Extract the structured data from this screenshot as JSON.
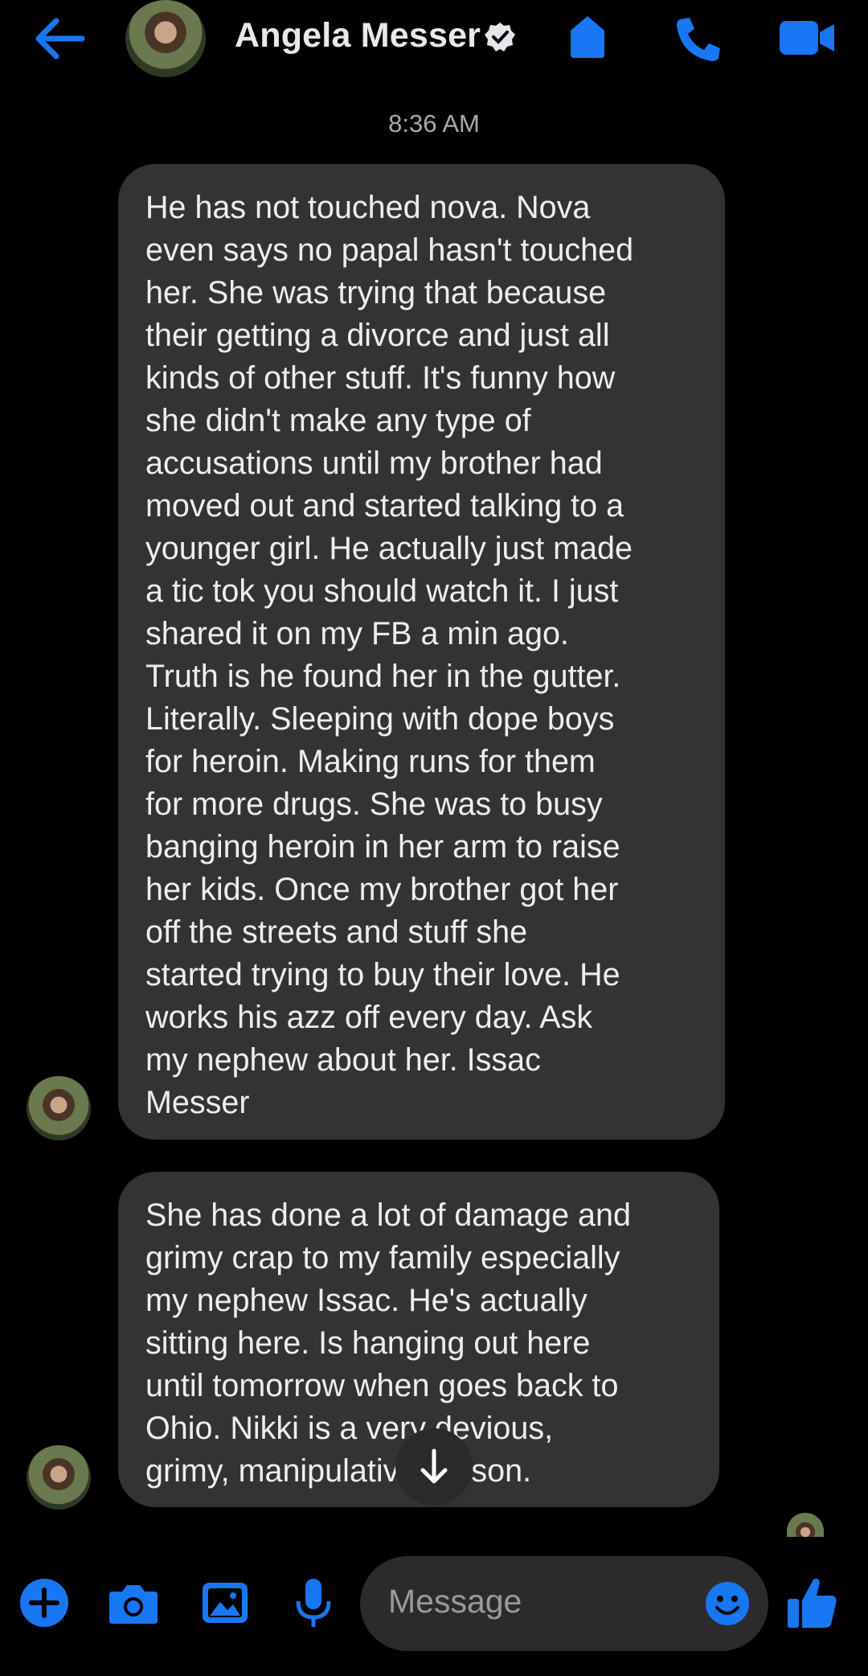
{
  "header": {
    "contact_name": "Angela Messer",
    "icons": [
      "back-arrow-icon",
      "verified-badge-icon",
      "shield-icon",
      "phone-icon",
      "video-camera-icon"
    ],
    "accent_color": "#1877f2"
  },
  "conversation": {
    "timestamp": "8:36 AM",
    "messages": [
      {
        "sender": "Angela Messer",
        "text": "He has not touched nova. Nova\neven says no papal hasn't touched\nher. She was trying that because\ntheir getting a divorce and just all\nkinds of other stuff. It's funny how\nshe didn't make any type of\naccusations until my brother had\nmoved out and started talking to a\nyounger girl. He actually just made\na tic tok you should watch it. I just\nshared it on my FB a min ago.\nTruth is he found her in the gutter.\nLiterally. Sleeping with dope boys\nfor heroin. Making runs for them\nfor more drugs. She was to busy\nbanging heroin in her arm to raise\nher kids. Once my brother got her\noff the streets and stuff she\nstarted trying to buy their love. He\nworks his azz off every day. Ask\nmy nephew about her. Issac\nMesser"
      },
      {
        "sender": "Angela Messer",
        "text": "She has done a lot of damage and\ngrimy crap to my family especially\nmy nephew Issac. He's actually\nsitting here. Is hanging out here\nuntil tomorrow when goes back to\nOhio. Nikki is a very devious,\ngrimy, manipulative person."
      }
    ]
  },
  "composer": {
    "placeholder": "Message",
    "icons": [
      "plus-icon",
      "camera-icon",
      "gallery-icon",
      "microphone-icon",
      "emoji-icon",
      "thumbs-up-icon"
    ]
  }
}
